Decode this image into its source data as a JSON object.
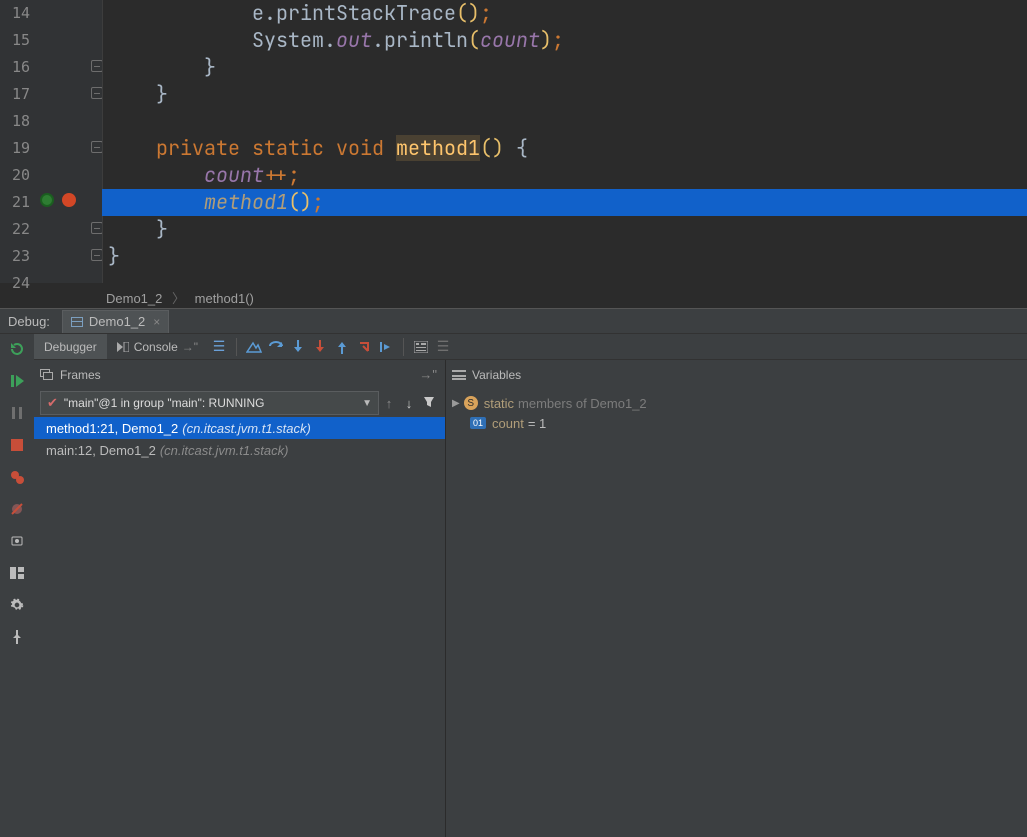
{
  "lines": {
    "14": {
      "indent": "            ",
      "tokens": [
        {
          "t": "e",
          "c": "c-id"
        },
        {
          "t": ".",
          "c": "c-id"
        },
        {
          "t": "printStackTrace",
          "c": "c-id"
        },
        {
          "t": "()",
          "c": "c-paren"
        },
        {
          "t": ";",
          "c": "c-punct"
        }
      ]
    },
    "15": {
      "indent": "            ",
      "tokens": [
        {
          "t": "System",
          "c": "c-id"
        },
        {
          "t": ".",
          "c": "c-id"
        },
        {
          "t": "out",
          "c": "c-field"
        },
        {
          "t": ".",
          "c": "c-id"
        },
        {
          "t": "println",
          "c": "c-id"
        },
        {
          "t": "(",
          "c": "c-paren"
        },
        {
          "t": "count",
          "c": "c-field"
        },
        {
          "t": ")",
          "c": "c-paren"
        },
        {
          "t": ";",
          "c": "c-punct"
        }
      ]
    },
    "16": {
      "indent": "        ",
      "tokens": [
        {
          "t": "}",
          "c": "c-brace"
        }
      ]
    },
    "17": {
      "indent": "    ",
      "tokens": [
        {
          "t": "}",
          "c": "c-brace"
        }
      ]
    },
    "18": {
      "indent": "",
      "tokens": []
    },
    "19": {
      "indent": "    ",
      "tokens": [
        {
          "t": "private",
          "c": "c-kw"
        },
        {
          "t": " "
        },
        {
          "t": "static",
          "c": "c-kw"
        },
        {
          "t": " "
        },
        {
          "t": "void",
          "c": "c-kw"
        },
        {
          "t": " "
        },
        {
          "t": "method1",
          "c": "c-meth c-hlname"
        },
        {
          "t": "()",
          "c": "c-paren"
        },
        {
          "t": " "
        },
        {
          "t": "{",
          "c": "c-brace"
        }
      ]
    },
    "20": {
      "indent": "        ",
      "tokens": [
        {
          "t": "count",
          "c": "c-field"
        },
        {
          "t": "++",
          "c": "c-op"
        },
        {
          "t": ";",
          "c": "c-punct"
        }
      ]
    },
    "21": {
      "indent": "        ",
      "tokens": [
        {
          "t": "method1",
          "c": "c-call"
        },
        {
          "t": "()",
          "c": "c-paren"
        },
        {
          "t": ";",
          "c": "c-punct"
        }
      ]
    },
    "22": {
      "indent": "    ",
      "tokens": [
        {
          "t": "}",
          "c": "c-brace"
        }
      ]
    },
    "23": {
      "indent": "",
      "tokens": [
        {
          "t": "}",
          "c": "c-brace"
        }
      ]
    },
    "24": {
      "indent": "",
      "tokens": []
    }
  },
  "breadcrumb": {
    "class": "Demo1_2",
    "method": "method1()"
  },
  "debug": {
    "label": "Debug:",
    "tab": "Demo1_2",
    "tabs": {
      "debugger": "Debugger",
      "console": "Console"
    },
    "frames_label": "Frames",
    "vars_label": "Variables",
    "thread": "\"main\"@1 in group \"main\": RUNNING",
    "frames": [
      {
        "loc": "method1:21, Demo1_2",
        "pkg": "(cn.itcast.jvm.t1.stack)",
        "sel": true
      },
      {
        "loc": "main:12, Demo1_2",
        "pkg": "(cn.itcast.jvm.t1.stack)",
        "sel": false
      }
    ],
    "vars": {
      "static_label": "static",
      "static_of": "members of Demo1_2",
      "count_name": "count",
      "count_val": "= 1"
    }
  }
}
